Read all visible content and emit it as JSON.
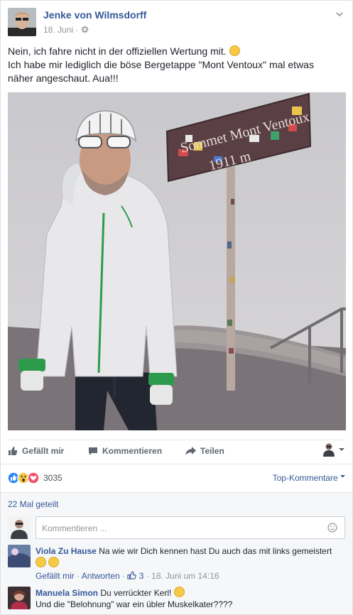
{
  "post": {
    "author": "Jenke von Wilmsdorff",
    "date": "18. Juni",
    "privacy_icon": "gear-icon",
    "text_line1": "Nein, ich fahre nicht in der offiziellen Wertung mit.",
    "text_line2": "Ich habe mir lediglich die böse Bergetappe \"Mont Ventoux\" mal etwas näher angeschaut. Aua!!!"
  },
  "photo": {
    "sign_line1": "Sommet Mont Ventoux",
    "sign_line2": "1911 m"
  },
  "actions": {
    "like": "Gefällt mir",
    "comment": "Kommentieren",
    "share": "Teilen"
  },
  "stats": {
    "reaction_count": "3035",
    "sort_label": "Top-Kommentare",
    "shares": "22 Mal geteilt"
  },
  "comment_box": {
    "placeholder": "Kommentieren ..."
  },
  "comments": [
    {
      "name": "Viola Zu Hause",
      "text": "Na wie wir Dich kennen hast Du auch das mit links gemeistert",
      "like": "Gefällt mir",
      "reply": "Antworten",
      "likes": "3",
      "time": "18. Juni um 14:16"
    },
    {
      "name": "Manuela Simon",
      "text1": "Du verrückter Kerl!",
      "text2": "Und die \"Belohnung\" war ein übler Muskelkater????"
    }
  ],
  "colors": {
    "link": "#365899",
    "muted": "#90949c",
    "like_blue": "#2d88ff",
    "love_red": "#f25268",
    "wow_yellow": "#f7c948"
  }
}
